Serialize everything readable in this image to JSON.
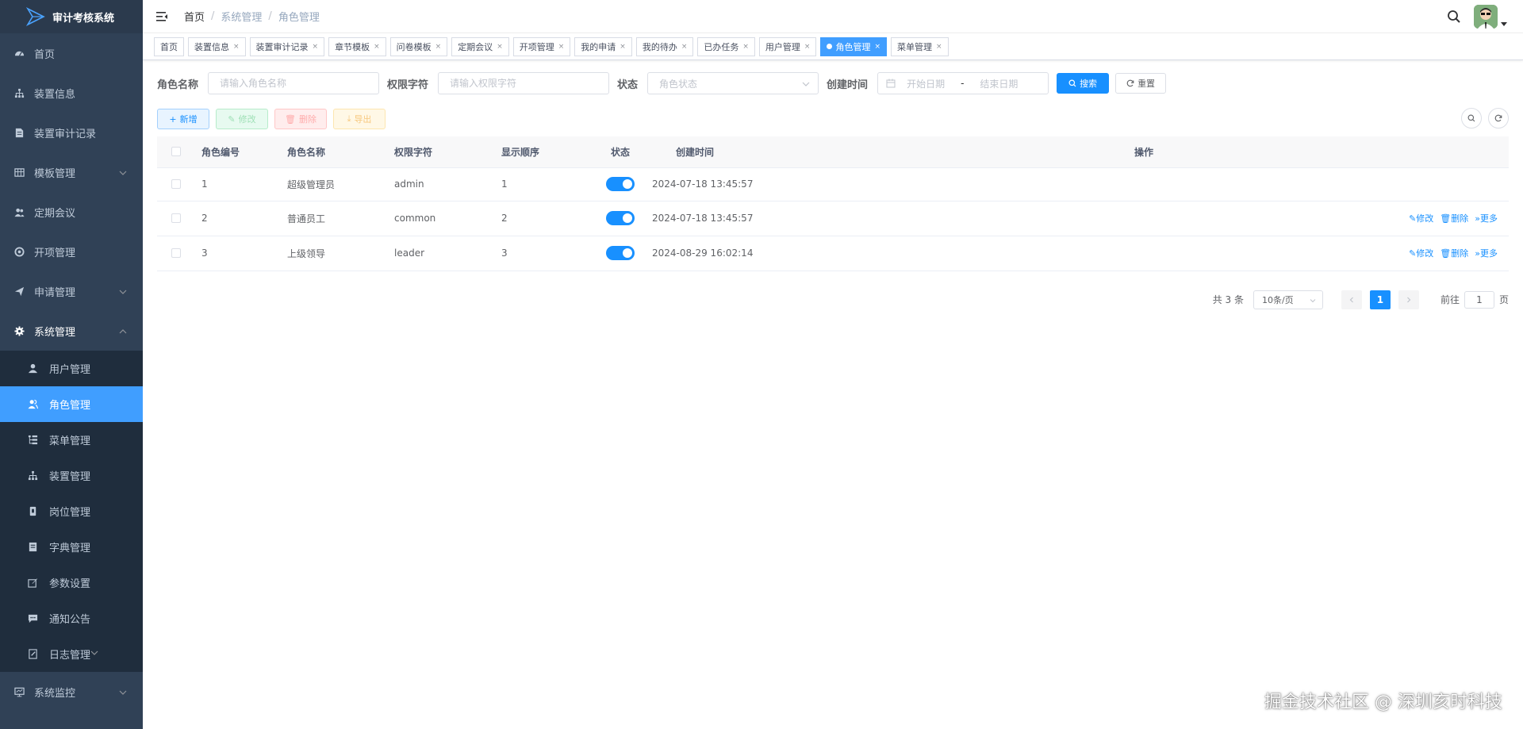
{
  "app": {
    "title": "审计考核系统"
  },
  "sidebar": {
    "items": [
      {
        "label": "首页",
        "icon": "dashboard-icon"
      },
      {
        "label": "装置信息",
        "icon": "tree-icon"
      },
      {
        "label": "装置审计记录",
        "icon": "document-icon"
      },
      {
        "label": "模板管理",
        "icon": "grid-icon",
        "expandable": true
      },
      {
        "label": "定期会议",
        "icon": "people-icon"
      },
      {
        "label": "开项管理",
        "icon": "settings-circle-icon"
      },
      {
        "label": "申请管理",
        "icon": "send-icon",
        "expandable": true
      },
      {
        "label": "系统管理",
        "icon": "gear-icon",
        "expandable": true,
        "open": true
      }
    ],
    "system_sub_items": [
      {
        "label": "用户管理",
        "icon": "user-icon"
      },
      {
        "label": "角色管理",
        "icon": "peoples-icon",
        "active": true
      },
      {
        "label": "菜单管理",
        "icon": "tree-table-icon"
      },
      {
        "label": "装置管理",
        "icon": "tree-icon"
      },
      {
        "label": "岗位管理",
        "icon": "post-icon"
      },
      {
        "label": "字典管理",
        "icon": "dict-icon"
      },
      {
        "label": "参数设置",
        "icon": "edit-icon"
      },
      {
        "label": "通知公告",
        "icon": "message-icon"
      },
      {
        "label": "日志管理",
        "icon": "log-icon",
        "expandable": true
      }
    ],
    "bottom_items": [
      {
        "label": "系统监控",
        "icon": "monitor-icon",
        "expandable": true
      }
    ]
  },
  "navbar": {
    "breadcrumb": [
      "首页",
      "系统管理",
      "角色管理"
    ],
    "separator": "/"
  },
  "tags": [
    {
      "label": "首页",
      "closable": false
    },
    {
      "label": "装置信息",
      "closable": true
    },
    {
      "label": "装置审计记录",
      "closable": true
    },
    {
      "label": "章节模板",
      "closable": true
    },
    {
      "label": "问卷模板",
      "closable": true
    },
    {
      "label": "定期会议",
      "closable": true
    },
    {
      "label": "开项管理",
      "closable": true
    },
    {
      "label": "我的申请",
      "closable": true
    },
    {
      "label": "我的待办",
      "closable": true
    },
    {
      "label": "已办任务",
      "closable": true
    },
    {
      "label": "用户管理",
      "closable": true
    },
    {
      "label": "角色管理",
      "closable": true,
      "active": true
    },
    {
      "label": "菜单管理",
      "closable": true
    }
  ],
  "search": {
    "role_name_label": "角色名称",
    "role_name_placeholder": "请输入角色名称",
    "role_key_label": "权限字符",
    "role_key_placeholder": "请输入权限字符",
    "status_label": "状态",
    "status_placeholder": "角色状态",
    "created_label": "创建时间",
    "start_placeholder": "开始日期",
    "range_sep": "-",
    "end_placeholder": "结束日期",
    "search_button": "搜索",
    "reset_button": "重置"
  },
  "toolbar": {
    "add": "新增",
    "edit": "修改",
    "delete": "删除",
    "export": "导出"
  },
  "table": {
    "headers": [
      "角色编号",
      "角色名称",
      "权限字符",
      "显示顺序",
      "状态",
      "创建时间",
      "操作"
    ],
    "rows": [
      {
        "id": "1",
        "name": "超级管理员",
        "key": "admin",
        "order": "1",
        "status": true,
        "created": "2024-07-18 13:45:57",
        "has_ops": false
      },
      {
        "id": "2",
        "name": "普通员工",
        "key": "common",
        "order": "2",
        "status": true,
        "created": "2024-07-18 13:45:57",
        "has_ops": true
      },
      {
        "id": "3",
        "name": "上级领导",
        "key": "leader",
        "order": "3",
        "status": true,
        "created": "2024-08-29 16:02:14",
        "has_ops": true
      }
    ],
    "ops": {
      "edit": "修改",
      "delete": "删除",
      "more": "更多"
    }
  },
  "pagination": {
    "total_text": "共 3 条",
    "page_size": "10条/页",
    "current_page": "1",
    "goto_label": "前往",
    "goto_value": "1",
    "page_suffix": "页"
  },
  "watermark": "掘金技术社区 @ 深圳亥时科技",
  "colors": {
    "sidebar_bg": "#304156",
    "active": "#409eff",
    "primary": "#1890ff"
  }
}
